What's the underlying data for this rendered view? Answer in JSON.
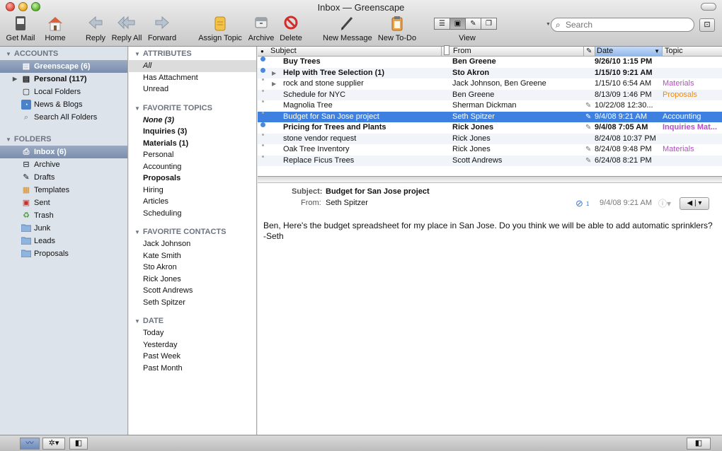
{
  "window": {
    "title": "Inbox — Greenscape"
  },
  "toolbar": {
    "buttons": [
      {
        "label": "Get Mail",
        "icon": "get-mail-icon"
      },
      {
        "label": "Home",
        "icon": "home-icon"
      },
      {
        "label": "Reply",
        "icon": "reply-icon"
      },
      {
        "label": "Reply All",
        "icon": "reply-all-icon"
      },
      {
        "label": "Forward",
        "icon": "forward-icon"
      },
      {
        "label": "Assign Topic",
        "icon": "topic-icon"
      },
      {
        "label": "Archive",
        "icon": "archive-icon"
      },
      {
        "label": "Delete",
        "icon": "delete-icon"
      },
      {
        "label": "New Message",
        "icon": "pen-icon"
      },
      {
        "label": "New To-Do",
        "icon": "todo-icon"
      }
    ],
    "view_label": "View",
    "search_placeholder": "Search"
  },
  "accounts": {
    "header": "ACCOUNTS",
    "items": [
      {
        "label": "Greenscape (6)",
        "icon": "account-icon",
        "selected": true,
        "bold": true
      },
      {
        "label": "Personal (117)",
        "icon": "account-icon",
        "bold": true
      },
      {
        "label": "Local Folders",
        "icon": "local-folders-icon"
      },
      {
        "label": "News & Blogs",
        "icon": "rss-icon"
      },
      {
        "label": "Search All Folders",
        "icon": "search-icon"
      }
    ]
  },
  "folders": {
    "header": "FOLDERS",
    "items": [
      {
        "label": "Inbox (6)",
        "icon": "inbox-icon",
        "selected": true
      },
      {
        "label": "Archive",
        "icon": "archive-icon"
      },
      {
        "label": "Drafts",
        "icon": "pencil-icon"
      },
      {
        "label": "Templates",
        "icon": "template-icon"
      },
      {
        "label": "Sent",
        "icon": "sent-icon"
      },
      {
        "label": "Trash",
        "icon": "trash-icon"
      },
      {
        "label": "Junk",
        "icon": "folder-icon"
      },
      {
        "label": "Leads",
        "icon": "folder-icon"
      },
      {
        "label": "Proposals",
        "icon": "folder-icon"
      }
    ]
  },
  "filters": {
    "attributes": {
      "header": "ATTRIBUTES",
      "items": [
        "All",
        "Has Attachment",
        "Unread"
      ]
    },
    "topics": {
      "header": "FAVORITE TOPICS",
      "items": [
        "None (3)",
        "Inquiries (3)",
        "Materials (1)",
        "Personal",
        "Accounting",
        "Proposals",
        "Hiring",
        "Articles",
        "Scheduling"
      ]
    },
    "contacts": {
      "header": "FAVORITE CONTACTS",
      "items": [
        "Jack Johnson",
        "Kate Smith",
        "Sto Akron",
        "Rick Jones",
        "Scott Andrews",
        "Seth Spitzer"
      ]
    },
    "date": {
      "header": "DATE",
      "items": [
        "Today",
        "Yesterday",
        "Past Week",
        "Past Month"
      ]
    }
  },
  "messagelist": {
    "columns": {
      "subject": "Subject",
      "from": "From",
      "date": "Date",
      "topic": "Topic"
    },
    "rows": [
      {
        "subject": "Buy Trees",
        "from": "Ben Greene",
        "date": "9/26/10 1:15 PM",
        "topic": "",
        "unread": true,
        "bold": true
      },
      {
        "subject": "Help with Tree Selection (1)",
        "from": "Sto Akron",
        "date": "1/15/10 9:21 AM",
        "topic": "",
        "unread": true,
        "bold": true,
        "thread": true
      },
      {
        "subject": "rock and stone supplier",
        "from": "Jack Johnson, Ben Greene",
        "date": "1/15/10 6:54 AM",
        "topic": "Materials",
        "topic_color": "#b44fc2",
        "thread": true
      },
      {
        "subject": "Schedule for NYC",
        "from": "Ben Greene",
        "date": "8/13/09 1:46 PM",
        "topic": "Proposals",
        "topic_color": "#e88a17"
      },
      {
        "subject": "Magnolia Tree",
        "from": "Sherman Dickman",
        "date": "10/22/08 12:30...",
        "topic": "",
        "attach": true
      },
      {
        "subject": "Budget for San Jose project",
        "from": "Seth Spitzer",
        "date": "9/4/08 9:21 AM",
        "topic": "Accounting",
        "selected": true,
        "attach": true
      },
      {
        "subject": "Pricing for Trees and Plants",
        "from": "Rick Jones",
        "date": "9/4/08 7:05 AM",
        "topic": "Inquiries Mat...",
        "topic_color": "#b44fc2",
        "unread": true,
        "bold": true,
        "attach": true
      },
      {
        "subject": "stone vendor request",
        "from": "Rick Jones",
        "date": "8/24/08 10:37 PM",
        "topic": ""
      },
      {
        "subject": "Oak Tree Inventory",
        "from": "Rick Jones",
        "date": "8/24/08 9:48 PM",
        "topic": "Materials",
        "topic_color": "#b44fc2",
        "attach": true
      },
      {
        "subject": "Replace Ficus Trees",
        "from": "Scott Andrews",
        "date": "6/24/08 8:21 PM",
        "topic": "",
        "attach": true
      }
    ]
  },
  "preview": {
    "subject_label": "Subject:",
    "subject": "Budget for San Jose project",
    "from_label": "From:",
    "from": "Seth Spitzer",
    "date": "9/4/08 9:21 AM",
    "attach_count": "1",
    "body_line1": "Ben, Here's the budget spreadsheet for my place in San Jose. Do you think we will be able to add automatic sprinklers?",
    "body_line2": "-Seth"
  },
  "colors": {
    "accent": "#3d80df",
    "sidebar": "#dde3ea"
  }
}
